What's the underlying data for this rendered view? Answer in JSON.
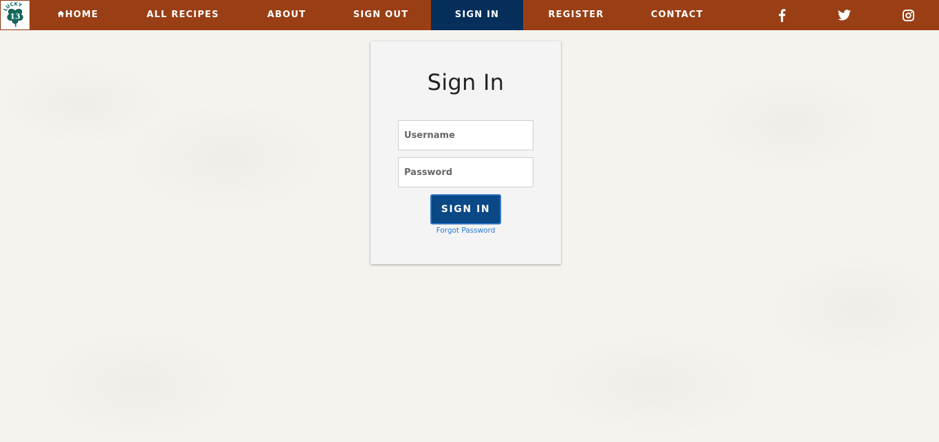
{
  "logo": {
    "text_top": "LUCKY",
    "number": "13"
  },
  "nav": {
    "home": "HOME",
    "all_recipes": "ALL RECIPES",
    "about": "ABOUT",
    "sign_out": "SIGN OUT",
    "sign_in": "SIGN IN",
    "register": "REGISTER",
    "contact": "CONTACT",
    "active": "sign_in"
  },
  "social": {
    "icons": [
      "facebook-icon",
      "twitter-icon",
      "instagram-icon"
    ]
  },
  "signin_form": {
    "title": "Sign In",
    "username_placeholder": "Username",
    "username_value": "",
    "password_placeholder": "Password",
    "password_value": "",
    "submit_label": "SIGN IN",
    "forgot_label": "Forgot Password"
  },
  "colors": {
    "nav_background": "#9a3f15",
    "nav_active": "#052e5a",
    "button_background": "#0a4886",
    "button_border": "#2c74c4",
    "link": "#2a7bd0",
    "page_background": "#f6f3ee",
    "card_background": "#f4f4f4"
  }
}
